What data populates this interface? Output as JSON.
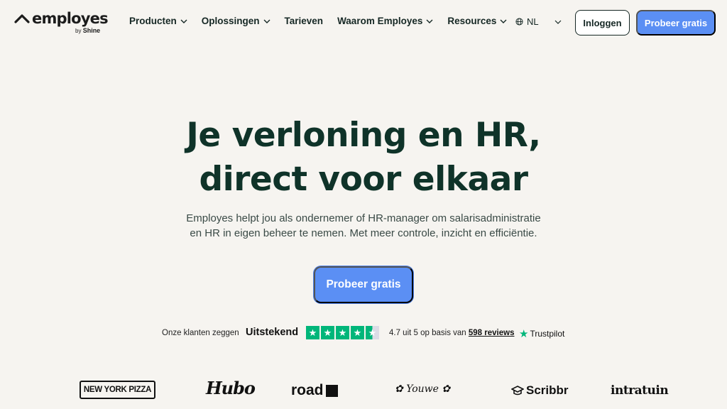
{
  "brand": {
    "name": "employes",
    "by": "by",
    "parent": "Shine"
  },
  "nav": {
    "items": [
      {
        "label": "Producten",
        "dropdown": true
      },
      {
        "label": "Oplossingen",
        "dropdown": true
      },
      {
        "label": "Tarieven",
        "dropdown": false
      },
      {
        "label": "Waarom Employes",
        "dropdown": true
      },
      {
        "label": "Resources",
        "dropdown": true
      }
    ],
    "language": "NL",
    "login_label": "Inloggen",
    "try_label": "Probeer gratis"
  },
  "hero": {
    "title_line1": "Je verloning en HR,",
    "title_line2": "direct voor elkaar",
    "subtitle_line1": "Employes helpt jou als ondernemer of HR-manager om salarisadministratie",
    "subtitle_line2": "en HR in eigen beheer te nemen. Met meer controle, inzicht en efficiëntie.",
    "cta_label": "Probeer gratis"
  },
  "trust": {
    "lead": "Onze klanten zeggen",
    "grade": "Uitstekend",
    "rating": 4.5,
    "score_text": "4.7 uit 5 op basis van",
    "reviews_link": "598 reviews",
    "provider": "Trustpilot"
  },
  "clients": [
    {
      "name": "NEW YORK PIZZA"
    },
    {
      "name": "Hubo"
    },
    {
      "name": "road"
    },
    {
      "name": "Youwe"
    },
    {
      "name": "Scribbr"
    },
    {
      "name": "intratuin"
    }
  ],
  "colors": {
    "background": "#f6f4f0",
    "accent": "#5b8ff4",
    "heading": "#0f3329",
    "trustpilot_green": "#00b67a"
  }
}
